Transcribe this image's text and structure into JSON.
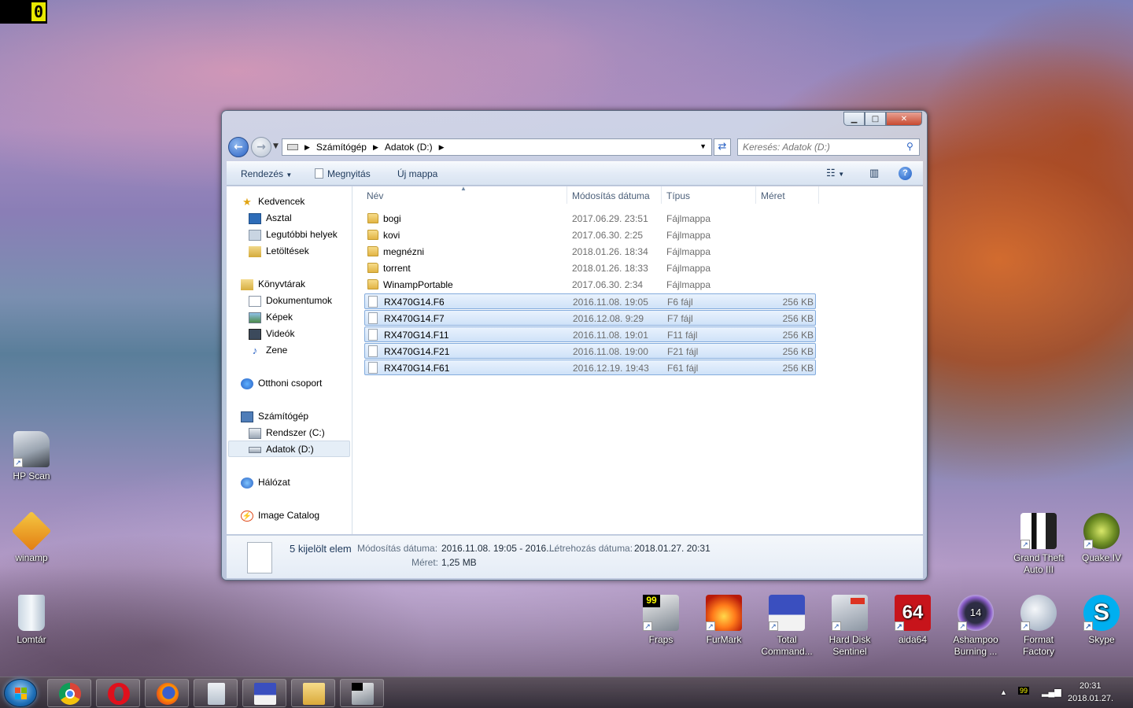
{
  "corner_counter": "0",
  "desktop_icons_left": [
    {
      "label": "HP Scan"
    },
    {
      "label": "winamp"
    },
    {
      "label": "Lomtár"
    }
  ],
  "desktop_icons_right_top": [
    {
      "label": "Grand Theft Auto III"
    },
    {
      "label": "Quake.IV"
    }
  ],
  "desktop_icons_bottom": [
    {
      "label": "Fraps"
    },
    {
      "label": "FurMark"
    },
    {
      "label": "Total Command..."
    },
    {
      "label": "Hard Disk Sentinel"
    },
    {
      "label": "aida64"
    },
    {
      "label": "Ashampoo Burning ..."
    },
    {
      "label": "Format Factory"
    },
    {
      "label": "Skype"
    }
  ],
  "window": {
    "address": {
      "root": "Számítógép",
      "current": "Adatok (D:)"
    },
    "search_placeholder": "Keresés: Adatok (D:)",
    "toolbar": {
      "organize": "Rendezés",
      "open": "Megnyitás",
      "new_folder": "Új mappa"
    },
    "nav": {
      "favorites": "Kedvencek",
      "desktop": "Asztal",
      "recent": "Legutóbbi helyek",
      "downloads": "Letöltések",
      "libraries": "Könyvtárak",
      "documents": "Dokumentumok",
      "pictures": "Képek",
      "videos": "Videók",
      "music": "Zene",
      "homegroup": "Otthoni csoport",
      "computer": "Számítógép",
      "drive_c": "Rendszer (C:)",
      "drive_d": "Adatok (D:)",
      "network": "Hálózat",
      "image_catalog": "Image Catalog"
    },
    "columns": {
      "name": "Név",
      "modified": "Módosítás dátuma",
      "type": "Típus",
      "size": "Méret"
    },
    "files": [
      {
        "name": "bogi",
        "modified": "2017.06.29. 23:51",
        "type": "Fájlmappa",
        "size": "",
        "folder": true,
        "selected": false
      },
      {
        "name": "kovi",
        "modified": "2017.06.30. 2:25",
        "type": "Fájlmappa",
        "size": "",
        "folder": true,
        "selected": false
      },
      {
        "name": "megnézni",
        "modified": "2018.01.26. 18:34",
        "type": "Fájlmappa",
        "size": "",
        "folder": true,
        "selected": false
      },
      {
        "name": "torrent",
        "modified": "2018.01.26. 18:33",
        "type": "Fájlmappa",
        "size": "",
        "folder": true,
        "selected": false
      },
      {
        "name": "WinampPortable",
        "modified": "2017.06.30. 2:34",
        "type": "Fájlmappa",
        "size": "",
        "folder": true,
        "selected": false
      },
      {
        "name": "RX470G14.F6",
        "modified": "2016.11.08. 19:05",
        "type": "F6 fájl",
        "size": "256 KB",
        "folder": false,
        "selected": true
      },
      {
        "name": "RX470G14.F7",
        "modified": "2016.12.08. 9:29",
        "type": "F7 fájl",
        "size": "256 KB",
        "folder": false,
        "selected": true
      },
      {
        "name": "RX470G14.F11",
        "modified": "2016.11.08. 19:01",
        "type": "F11 fájl",
        "size": "256 KB",
        "folder": false,
        "selected": true
      },
      {
        "name": "RX470G14.F21",
        "modified": "2016.11.08. 19:00",
        "type": "F21 fájl",
        "size": "256 KB",
        "folder": false,
        "selected": true
      },
      {
        "name": "RX470G14.F61",
        "modified": "2016.12.19. 19:43",
        "type": "F61 fájl",
        "size": "256 KB",
        "folder": false,
        "selected": true
      }
    ],
    "details": {
      "title": "5 kijelölt elem",
      "modified_label": "Módosítás dátuma:",
      "modified_value": "2016.11.08. 19:05 - 2016....",
      "created_label": "Létrehozás dátuma:",
      "created_value": "2018.01.27. 20:31",
      "size_label": "Méret:",
      "size_value": "1,25 MB"
    }
  },
  "taskbar": {
    "apps": [
      "chrome-icon",
      "opera-icon",
      "firefox-icon",
      "calculator-icon",
      "total-commander-icon",
      "explorer-icon",
      "fraps-icon"
    ],
    "tray_badge": "99",
    "time": "20:31",
    "date": "2018.01.27."
  }
}
